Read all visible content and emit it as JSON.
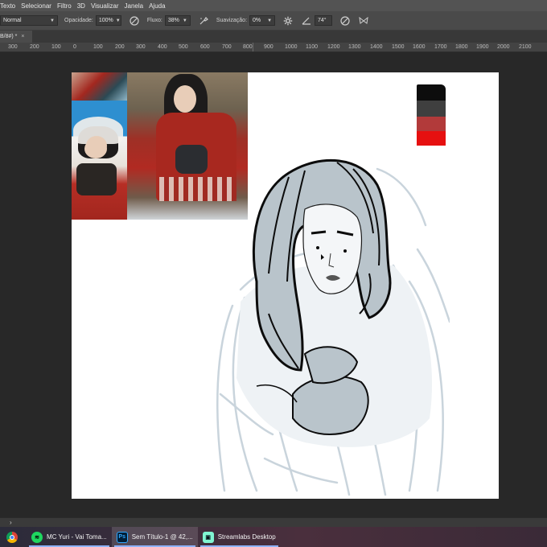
{
  "menubar": {
    "items": [
      "Texto",
      "Selecionar",
      "Filtro",
      "3D",
      "Visualizar",
      "Janela",
      "Ajuda"
    ]
  },
  "options": {
    "mode": "Normal",
    "opacity_label": "Opacidade:",
    "opacity_value": "100%",
    "flow_label": "Fluxo:",
    "flow_value": "38%",
    "smoothing_label": "Suavização:",
    "smoothing_value": "0%",
    "angle_value": "74°"
  },
  "document": {
    "tab_label": "B/8#) *",
    "close_glyph": "×"
  },
  "ruler": {
    "labels": [
      "300",
      "200",
      "100",
      "0",
      "100",
      "200",
      "300",
      "400",
      "500",
      "600",
      "700",
      "800",
      "900",
      "1000",
      "1100",
      "1200",
      "1300",
      "1400",
      "1500",
      "1600",
      "1700",
      "1800",
      "1900",
      "2000",
      "2100"
    ]
  },
  "swatches": {
    "colors": [
      "#0d0d0d",
      "#3f3f3f",
      "#b23a3a",
      "#e61010"
    ]
  },
  "statusbar": {
    "arrow": "›"
  },
  "taskbar": {
    "chrome_icon": "chrome-icon",
    "spotify_label": "MC Yuri - Vai Toma...",
    "photoshop_label": "Sem Título-1 @ 42,...",
    "photoshop_icon_text": "Ps",
    "streamlabs_label": "Streamlabs Desktop"
  }
}
